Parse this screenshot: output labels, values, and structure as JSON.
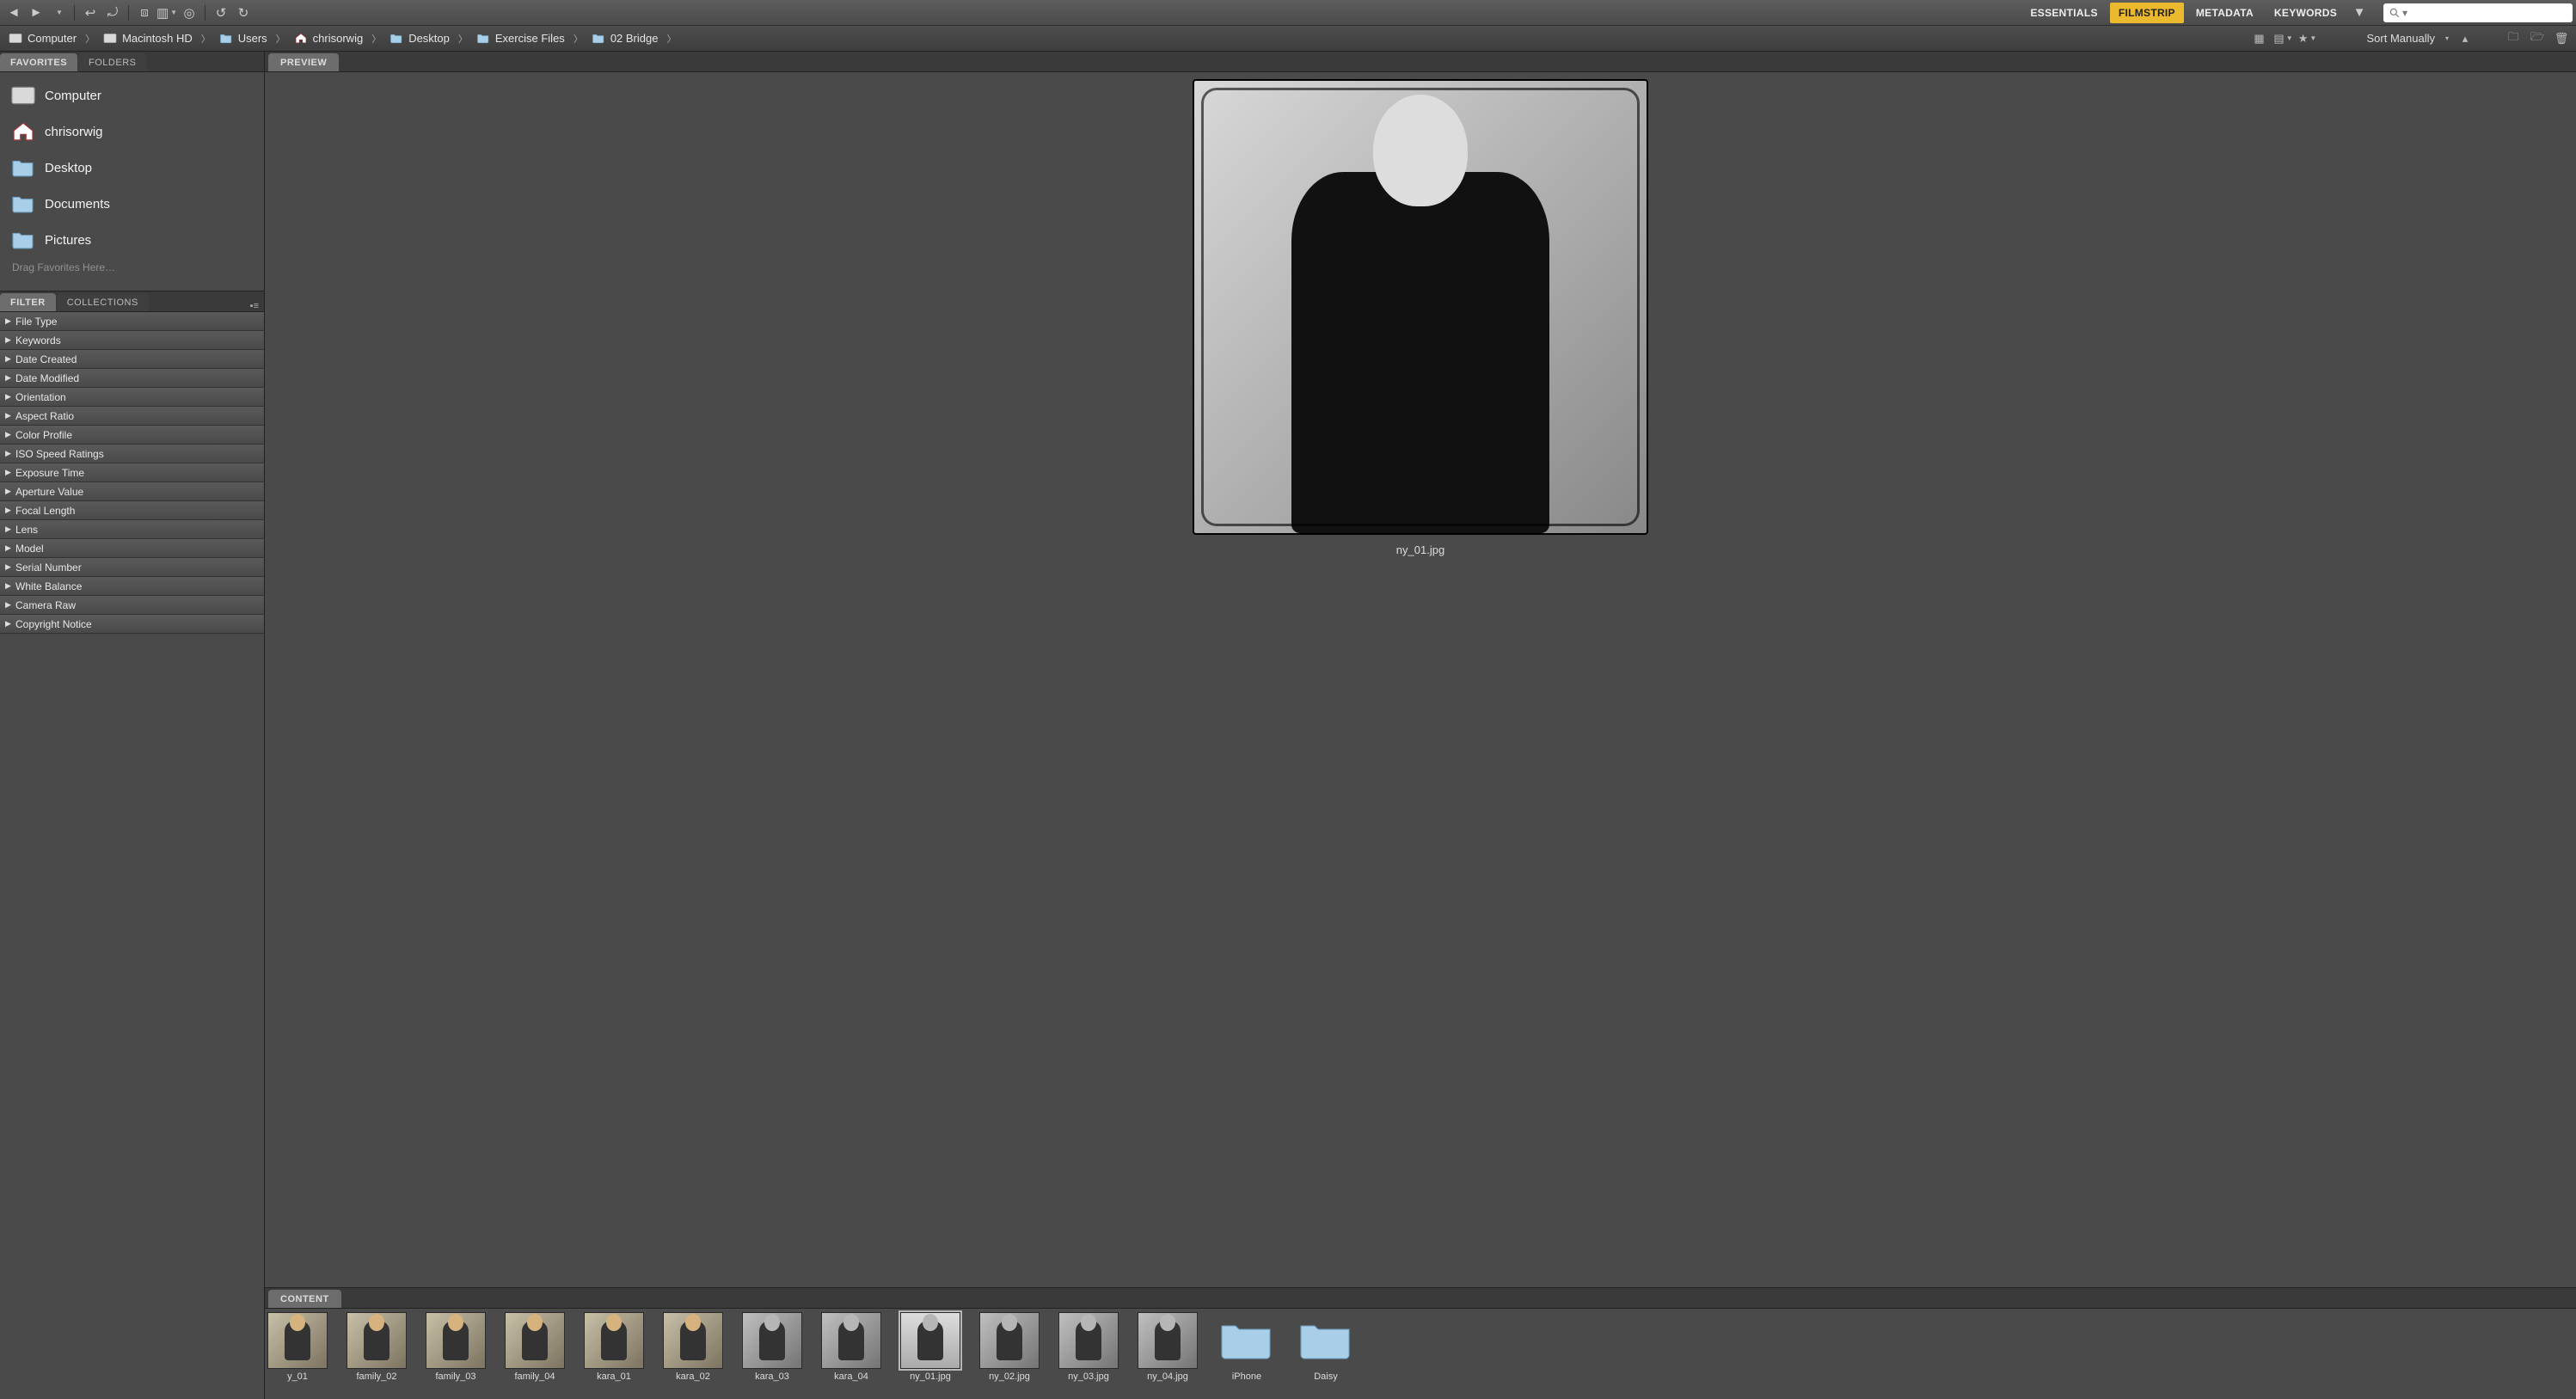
{
  "workspaces": {
    "essentials": "ESSENTIALS",
    "filmstrip": "FILMSTRIP",
    "metadata": "METADATA",
    "keywords": "KEYWORDS",
    "active": "filmstrip"
  },
  "search": {
    "placeholder": ""
  },
  "breadcrumbs": [
    {
      "label": "Computer",
      "icon": "drive"
    },
    {
      "label": "Macintosh HD",
      "icon": "drive"
    },
    {
      "label": "Users",
      "icon": "folder"
    },
    {
      "label": "chrisorwig",
      "icon": "home"
    },
    {
      "label": "Desktop",
      "icon": "folder"
    },
    {
      "label": "Exercise Files",
      "icon": "folder"
    },
    {
      "label": "02 Bridge",
      "icon": "folder"
    }
  ],
  "pathbar_right": {
    "sort_label": "Sort Manually"
  },
  "sidebar": {
    "tabs": {
      "favorites": "FAVORITES",
      "folders": "FOLDERS"
    },
    "items": [
      {
        "label": "Computer",
        "icon": "drive"
      },
      {
        "label": "chrisorwig",
        "icon": "home"
      },
      {
        "label": "Desktop",
        "icon": "folder"
      },
      {
        "label": "Documents",
        "icon": "folder"
      },
      {
        "label": "Pictures",
        "icon": "folder"
      }
    ],
    "hint": "Drag Favorites Here…"
  },
  "filter_panel": {
    "tabs": {
      "filter": "FILTER",
      "collections": "COLLECTIONS"
    },
    "rows": [
      "File Type",
      "Keywords",
      "Date Created",
      "Date Modified",
      "Orientation",
      "Aspect Ratio",
      "Color Profile",
      "ISO Speed Ratings",
      "Exposure Time",
      "Aperture Value",
      "Focal Length",
      "Lens",
      "Model",
      "Serial Number",
      "White Balance",
      "Camera Raw",
      "Copyright Notice"
    ]
  },
  "preview": {
    "tab": "PREVIEW",
    "caption": "ny_01.jpg",
    "selected_index": 8
  },
  "content": {
    "tab": "CONTENT",
    "thumbs": [
      {
        "name": "y_01",
        "bw": false,
        "folder": false
      },
      {
        "name": "family_02",
        "bw": false,
        "folder": false
      },
      {
        "name": "family_03",
        "bw": false,
        "folder": false
      },
      {
        "name": "family_04",
        "bw": false,
        "folder": false
      },
      {
        "name": "kara_01",
        "bw": false,
        "folder": false
      },
      {
        "name": "kara_02",
        "bw": false,
        "folder": false
      },
      {
        "name": "kara_03",
        "bw": true,
        "folder": false
      },
      {
        "name": "kara_04",
        "bw": true,
        "folder": false
      },
      {
        "name": "ny_01.jpg",
        "bw": true,
        "folder": false
      },
      {
        "name": "ny_02.jpg",
        "bw": true,
        "folder": false
      },
      {
        "name": "ny_03.jpg",
        "bw": true,
        "folder": false
      },
      {
        "name": "ny_04.jpg",
        "bw": true,
        "folder": false
      },
      {
        "name": "iPhone",
        "bw": false,
        "folder": true
      },
      {
        "name": "Daisy",
        "bw": false,
        "folder": true
      }
    ]
  }
}
